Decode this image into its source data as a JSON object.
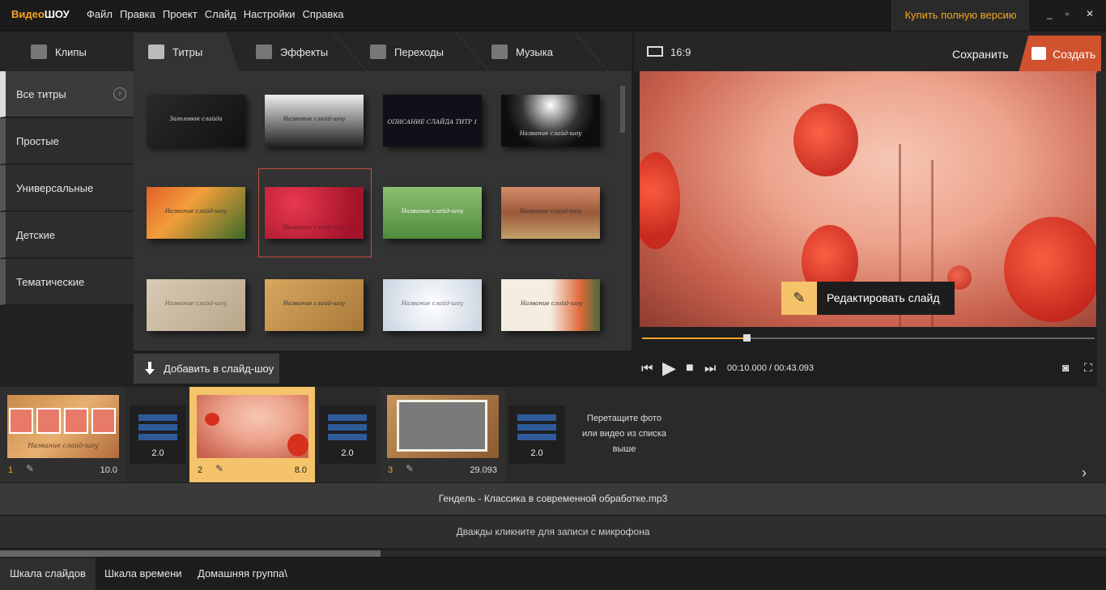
{
  "app": {
    "logo_part1": "Видео",
    "logo_part2": "ШОУ"
  },
  "menu": [
    "Файл",
    "Правка",
    "Проект",
    "Слайд",
    "Настройки",
    "Справка"
  ],
  "buy_label": "Купить полную версию",
  "window_controls": {
    "minimize": "_",
    "maximize": "▫",
    "close": "✕"
  },
  "tabs": [
    {
      "label": "Клипы",
      "icon": "clips-icon"
    },
    {
      "label": "Титры",
      "icon": "titles-icon"
    },
    {
      "label": "Эффекты",
      "icon": "effects-icon"
    },
    {
      "label": "Переходы",
      "icon": "transitions-icon"
    },
    {
      "label": "Музыка",
      "icon": "music-icon"
    }
  ],
  "categories": [
    "Все титры",
    "Простые",
    "Универсальные",
    "Детские",
    "Тематические"
  ],
  "thumbnails": [
    {
      "label": "Заголовок слайда"
    },
    {
      "label": "Название слайд-шоу"
    },
    {
      "label": "ОПИСАНИЕ СЛАЙДА   ТИТР 1"
    },
    {
      "label": "Название слайд-шоу"
    },
    {
      "label": "Название слайд-шоу"
    },
    {
      "label": "Название слайд-шоу"
    },
    {
      "label": "Название слайд-шоу"
    },
    {
      "label": "Название слайд-шоу"
    },
    {
      "label": "Название слайд-шоу"
    },
    {
      "label": "Название слайд-шоу"
    },
    {
      "label": "Название слайд-шоу"
    },
    {
      "label": "Название слайд-шоу"
    }
  ],
  "add_button": "Добавить в слайд-шоу",
  "preview": {
    "ratio": "16:9",
    "save": "Сохранить",
    "create": "Создать",
    "edit_slide": "Редактировать слайд",
    "time_current": "00:10.000",
    "time_sep": " / ",
    "time_total": "00:43.093",
    "progress": 0.23
  },
  "timeline": {
    "slides": [
      {
        "num": "1",
        "dur": "10.0",
        "caption": "Название слайд-шоу"
      },
      {
        "num": "2",
        "dur": "8.0"
      },
      {
        "num": "3",
        "dur": "29.093"
      }
    ],
    "transitions": [
      "2.0",
      "2.0",
      "2.0"
    ],
    "drop_hint": "Перетащите фото или видео из списка выше"
  },
  "music_track": "Гендель - Классика в современной обработке.mp3",
  "mic_hint": "Дважды кликните для записи с микрофона",
  "bottom_tabs": [
    "Шкала слайдов",
    "Шкала времени",
    "Домашняя группа\\"
  ],
  "colors": {
    "accent": "#f5a623",
    "create": "#d0522e",
    "active_slide": "#f5c46a"
  }
}
